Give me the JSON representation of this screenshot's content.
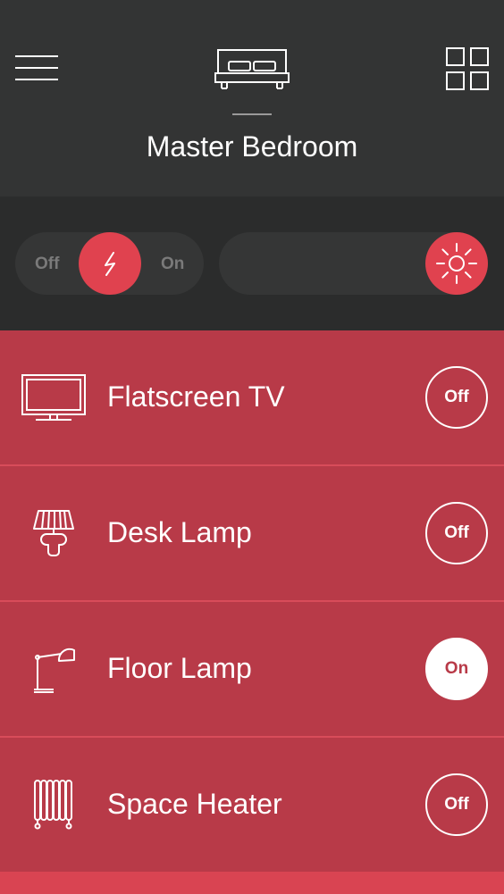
{
  "colors": {
    "header_bg": "#333434",
    "controls_bg": "#2b2c2c",
    "accent": "#e0424f",
    "list_bg": "#b83a48",
    "row_divider": "#d84c5a"
  },
  "header": {
    "room_icon": "bed-icon",
    "title": "Master Bedroom",
    "menu_icon": "hamburger-menu-icon",
    "grid_icon": "grid-view-icon"
  },
  "controls": {
    "power": {
      "off_label": "Off",
      "on_label": "On",
      "icon": "lightning-bolt-icon"
    },
    "brightness": {
      "icon": "sun-icon",
      "level": 1.0
    }
  },
  "devices": [
    {
      "name": "Flatscreen TV",
      "icon": "tv-icon",
      "state": "Off"
    },
    {
      "name": "Desk Lamp",
      "icon": "desk-lamp-icon",
      "state": "Off"
    },
    {
      "name": "Floor Lamp",
      "icon": "floor-lamp-icon",
      "state": "On"
    },
    {
      "name": "Space Heater",
      "icon": "space-heater-icon",
      "state": "Off"
    }
  ]
}
